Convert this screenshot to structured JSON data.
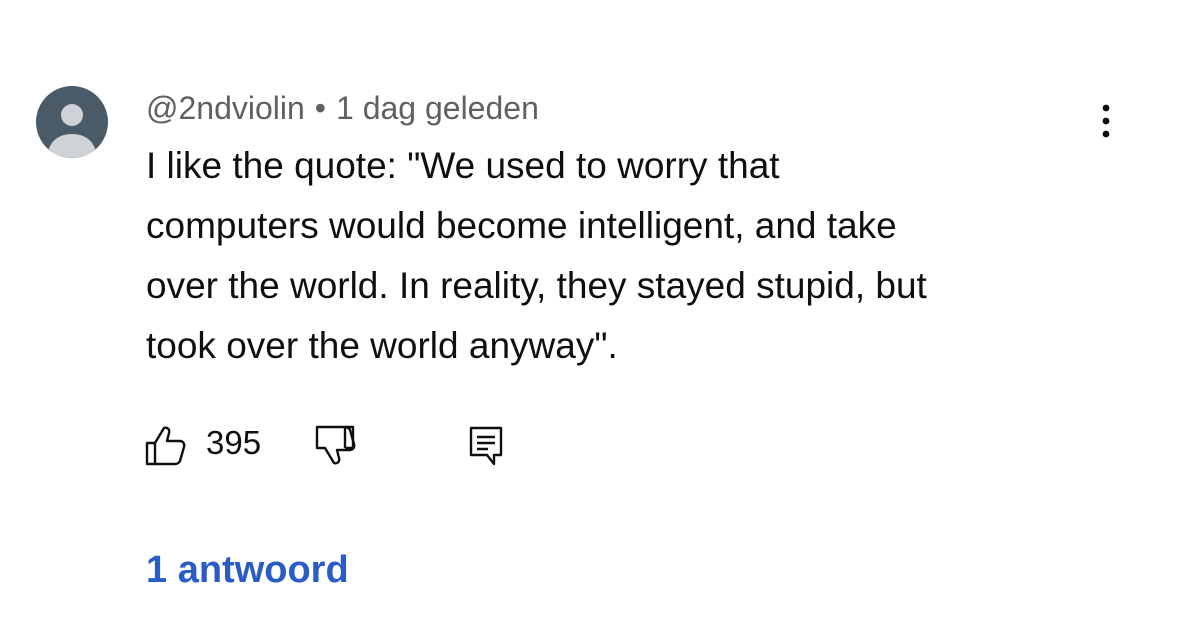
{
  "comment": {
    "author": "@2ndviolin",
    "separator": "•",
    "time": "1 dag geleden",
    "lines": [
      "I like the quote: \"We used to worry that",
      "computers would become intelligent, and take",
      "over the world. In reality, they stayed stupid, but",
      "took over the world anyway\"."
    ],
    "like_count": "395",
    "replies_label": "1 antwoord"
  },
  "colors": {
    "avatar_bg": "#4b5a67",
    "avatar_fg": "#cfd3d7",
    "meta_text": "#606060",
    "body_text": "#0f0f0f",
    "link": "#2a5cc5"
  },
  "icons": {
    "avatar": "person-icon",
    "more": "more-vertical-icon",
    "like": "thumbs-up-icon",
    "dislike": "thumbs-down-icon",
    "reply": "comment-reply-icon"
  }
}
